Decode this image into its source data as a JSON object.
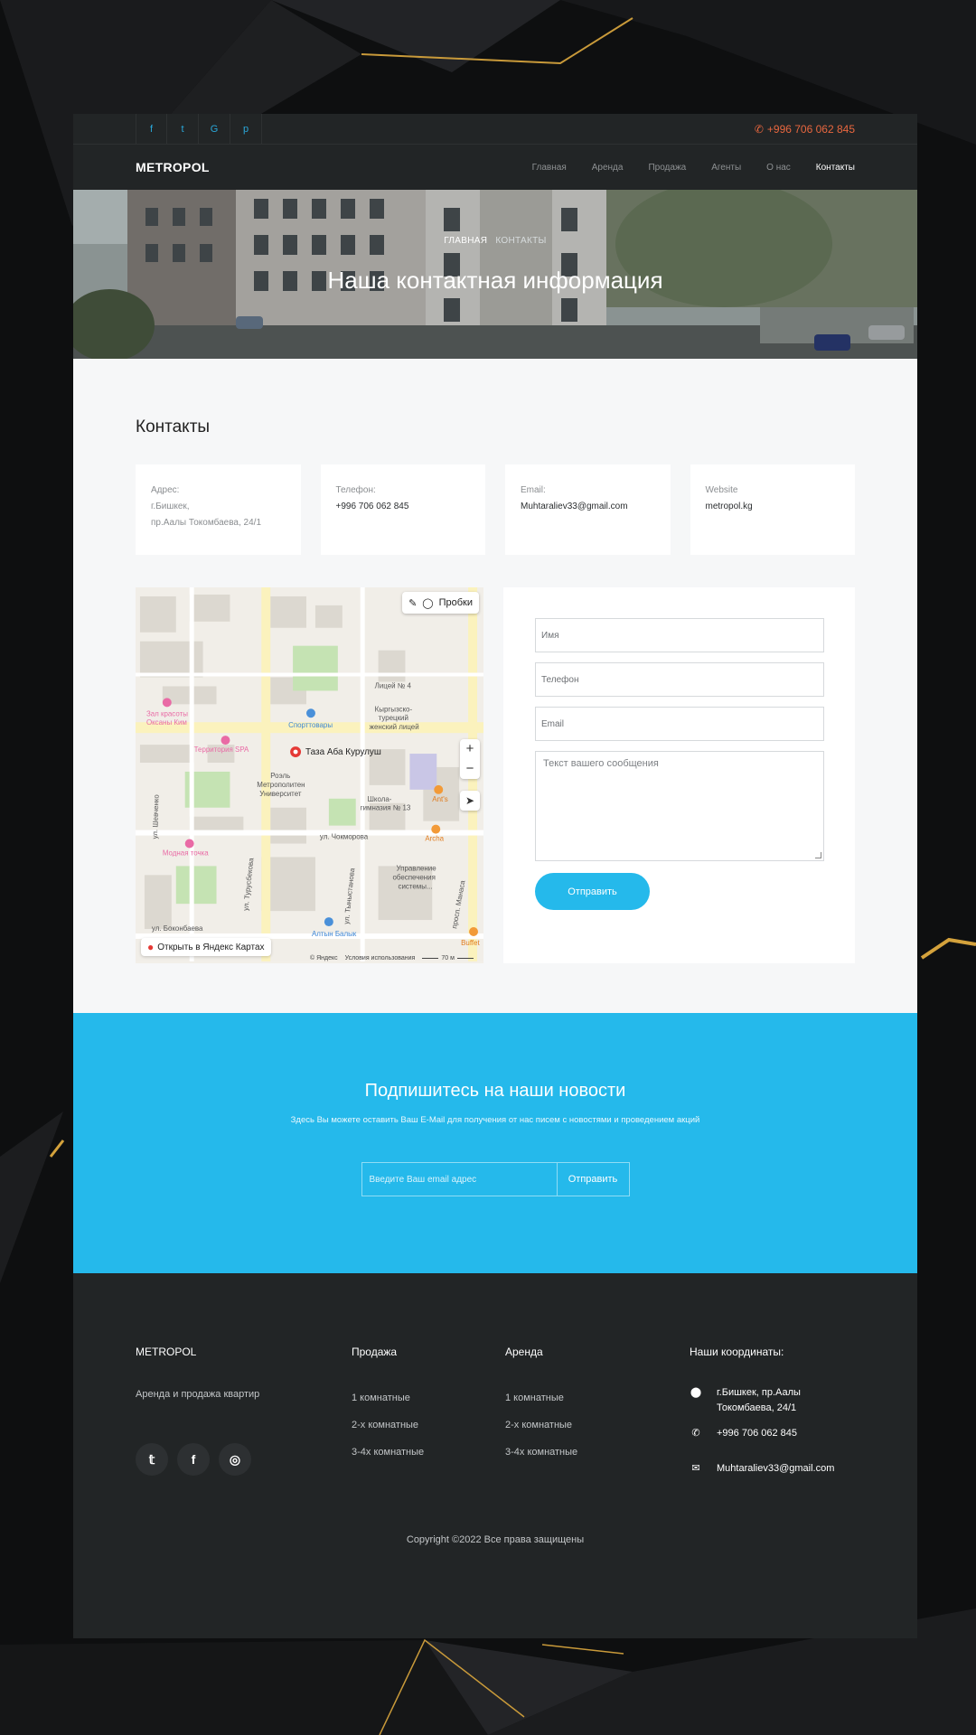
{
  "topbar": {
    "socials": [
      "facebook",
      "twitter",
      "google",
      "pinterest"
    ],
    "social_glyphs": [
      "f",
      "t",
      "G",
      "p"
    ],
    "phone": "+996 706 062 845"
  },
  "nav": {
    "logo": "METROPOL",
    "items": [
      {
        "label": "Главная"
      },
      {
        "label": "Аренда"
      },
      {
        "label": "Продажа"
      },
      {
        "label": "Агенты"
      },
      {
        "label": "О нас"
      },
      {
        "label": "Контакты"
      }
    ]
  },
  "hero": {
    "breadcrumb_home": "ГЛАВНАЯ",
    "breadcrumb_current": "КОНТАКТЫ",
    "title": "Наша контактная информация"
  },
  "contacts": {
    "title": "Контакты",
    "address_label": "Адрес:",
    "address_line1": "г.Бишкек,",
    "address_line2": "пр.Аалы Токомбаева, 24/1",
    "phone_label": "Телефон:",
    "phone_value": "+996 706 062 845",
    "email_label": "Email:",
    "email_value": "Muhtaraliev33@gmail.com",
    "website_label": "Website",
    "website_value": "metropol.kg"
  },
  "map": {
    "traffic": "Пробки",
    "poi_label": "Таза Аба Курулуш",
    "open_link": "Открыть в Яндекс Картах",
    "copyright": "© Яндекс",
    "terms": "Условия использования",
    "scale": "70 м",
    "labels": {
      "lyceum": "Лицей № 4",
      "kg_lyceum1": "Кыргызско-",
      "kg_lyceum2": "турецкий",
      "kg_lyceum3": "женский лицей",
      "sports": "Спорттовары",
      "beauty1": "Зал красоты",
      "beauty2": "Оксаны Ким",
      "spa": "Территория SPA",
      "univ1": "Роэль",
      "univ2": "Метрополитен",
      "univ3": "Университет",
      "school1": "Школа-",
      "school2": "гимназия № 13",
      "ants": "Ant's",
      "archa": "Archa",
      "street1": "ул. Чокморова",
      "street2": "ул. Боконбаева",
      "street3": "просп. Манаса",
      "street4": "ул. Турусбекова",
      "street5": "ул. Тыныстанова",
      "street6": "ул. Шевченко",
      "fashion": "Модная точка",
      "supply1": "Управление",
      "supply2": "обеспечения",
      "supply3": "системы...",
      "altyn": "Алтын Балык",
      "buffet": "Buffet"
    }
  },
  "form": {
    "name_placeholder": "Имя",
    "phone_placeholder": "Телефон",
    "email_placeholder": "Email",
    "message_placeholder": "Текст вашего сообщения",
    "submit": "Отправить"
  },
  "subscribe": {
    "title": "Подпишитесь на наши новости",
    "description": "Здесь Вы можете оставить Ваш E-Mail для получения от нас писем с новостями и проведением акций",
    "input_placeholder": "Введите Ваш email адрес",
    "button": "Отправить"
  },
  "footer": {
    "logo": "METROPOL",
    "tagline": "Аренда и продажа квартир",
    "social_icons": [
      "twitter",
      "facebook",
      "instagram"
    ],
    "sale_title": "Продажа",
    "sale_items": [
      "1 комнатные",
      "2-х комнатные",
      "3-4х комнатные"
    ],
    "rent_title": "Аренда",
    "rent_items": [
      "1 комнатные",
      "2-х комнатные",
      "3-4х комнатные"
    ],
    "coords_title": "Наши координаты:",
    "coords_address": "г.Бишкек, пр.Аалы Токомбаева, 24/1",
    "coords_phone": "+996 706 062 845",
    "coords_email": "Muhtaraliev33@gmail.com",
    "copyright": "Copyright ©2022 Все права защищены"
  },
  "colors": {
    "accent": "#25b9eb",
    "phone_accent": "#e9673f",
    "dark_bg": "#222526",
    "light_section": "#f6f7f8"
  }
}
